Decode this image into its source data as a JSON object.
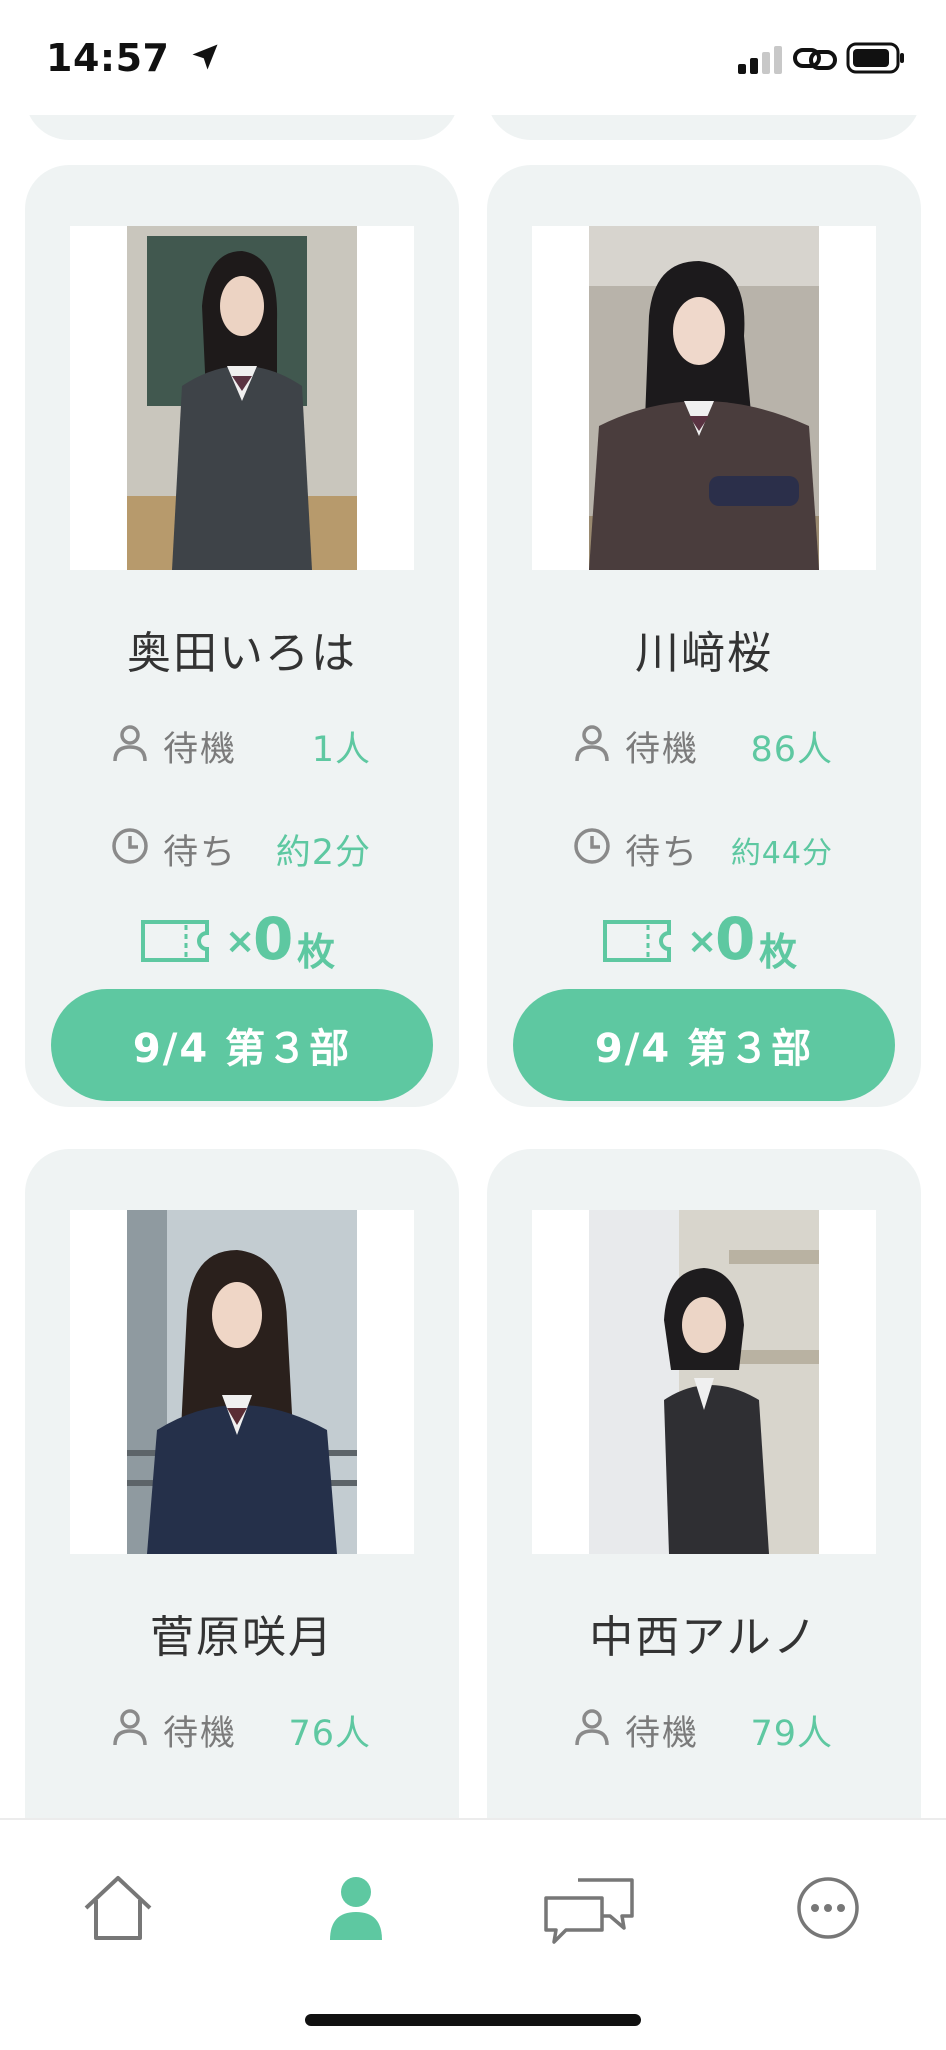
{
  "status_bar": {
    "time": "14:57",
    "icons": [
      "location-arrow-icon",
      "cellular-signal-icon",
      "personal-hotspot-link-icon",
      "battery-icon"
    ]
  },
  "colors": {
    "accent": "#5ec8a1",
    "card_bg": "#eff3f3",
    "label_gray": "#7b7b7b"
  },
  "members": [
    {
      "name": "奥田いろは",
      "wait_label": "待機",
      "wait_value": "1人",
      "time_label": "待ち",
      "time_value": "約2分",
      "ticket_x": "×",
      "ticket_count": "0",
      "ticket_unit": "枚",
      "session_label": "9/4 第３部"
    },
    {
      "name": "川﨑桜",
      "wait_label": "待機",
      "wait_value": "86人",
      "time_label": "待ち",
      "time_value": "約44分",
      "ticket_x": "×",
      "ticket_count": "0",
      "ticket_unit": "枚",
      "session_label": "9/4 第３部"
    },
    {
      "name": "菅原咲月",
      "wait_label": "待機",
      "wait_value": "76人"
    },
    {
      "name": "中西アルノ",
      "wait_label": "待機",
      "wait_value": "79人"
    }
  ],
  "tab_bar": {
    "tabs": [
      {
        "icon": "home-icon",
        "active": false
      },
      {
        "icon": "person-icon",
        "active": true
      },
      {
        "icon": "chat-bubbles-icon",
        "active": false
      },
      {
        "icon": "more-icon",
        "active": false
      }
    ]
  }
}
